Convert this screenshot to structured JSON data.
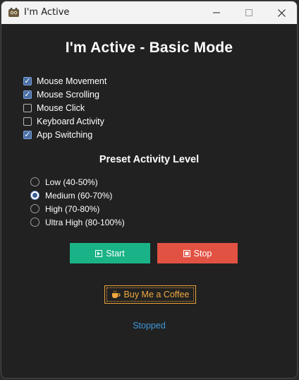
{
  "window": {
    "title": "I'm Active",
    "icon": "app-mascot-icon",
    "controls": [
      "minimize-icon",
      "maximize-icon",
      "close-icon"
    ]
  },
  "main_title": "I'm Active - Basic Mode",
  "options": [
    {
      "label": "Mouse Movement",
      "checked": true
    },
    {
      "label": "Mouse Scrolling",
      "checked": true
    },
    {
      "label": "Mouse Click",
      "checked": false
    },
    {
      "label": "Keyboard Activity",
      "checked": false
    },
    {
      "label": "App Switching",
      "checked": true
    }
  ],
  "preset": {
    "title": "Preset Activity Level",
    "levels": [
      {
        "label": "Low (40-50%)",
        "selected": false
      },
      {
        "label": "Medium (60-70%)",
        "selected": true
      },
      {
        "label": "High (70-80%)",
        "selected": false
      },
      {
        "label": "Ultra High (80-100%)",
        "selected": false
      }
    ]
  },
  "buttons": {
    "start_label": "Start",
    "stop_label": "Stop",
    "coffee_label": "Buy Me a Coffee"
  },
  "status": "Stopped",
  "colors": {
    "start": "#1ab388",
    "stop": "#e25243",
    "coffee": "#e9a23b",
    "status": "#3f98d8",
    "background": "#212121"
  }
}
